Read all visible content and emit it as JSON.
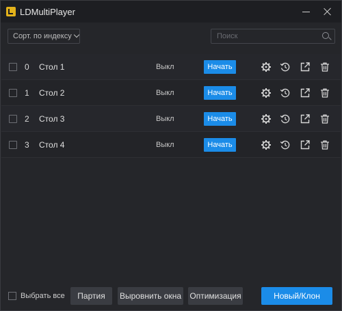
{
  "window": {
    "title": "LDMultiPlayer"
  },
  "toolbar": {
    "sort_label": "Сорт. по индексу",
    "search_placeholder": "Поиск"
  },
  "instances": [
    {
      "index": "0",
      "name": "Стол 1",
      "status": "Выкл",
      "action": "Начать"
    },
    {
      "index": "1",
      "name": "Стол 2",
      "status": "Выкл",
      "action": "Начать"
    },
    {
      "index": "2",
      "name": "Стол 3",
      "status": "Выкл",
      "action": "Начать"
    },
    {
      "index": "3",
      "name": "Стол 4",
      "status": "Выкл",
      "action": "Начать"
    }
  ],
  "footer": {
    "select_all": "Выбрать все",
    "party": "Партия",
    "align": "Выровнить окна",
    "optimize": "Оптимизация",
    "new_clone": "Новый/Клон"
  },
  "colors": {
    "accent": "#1b8ce8",
    "background": "#25262a"
  }
}
